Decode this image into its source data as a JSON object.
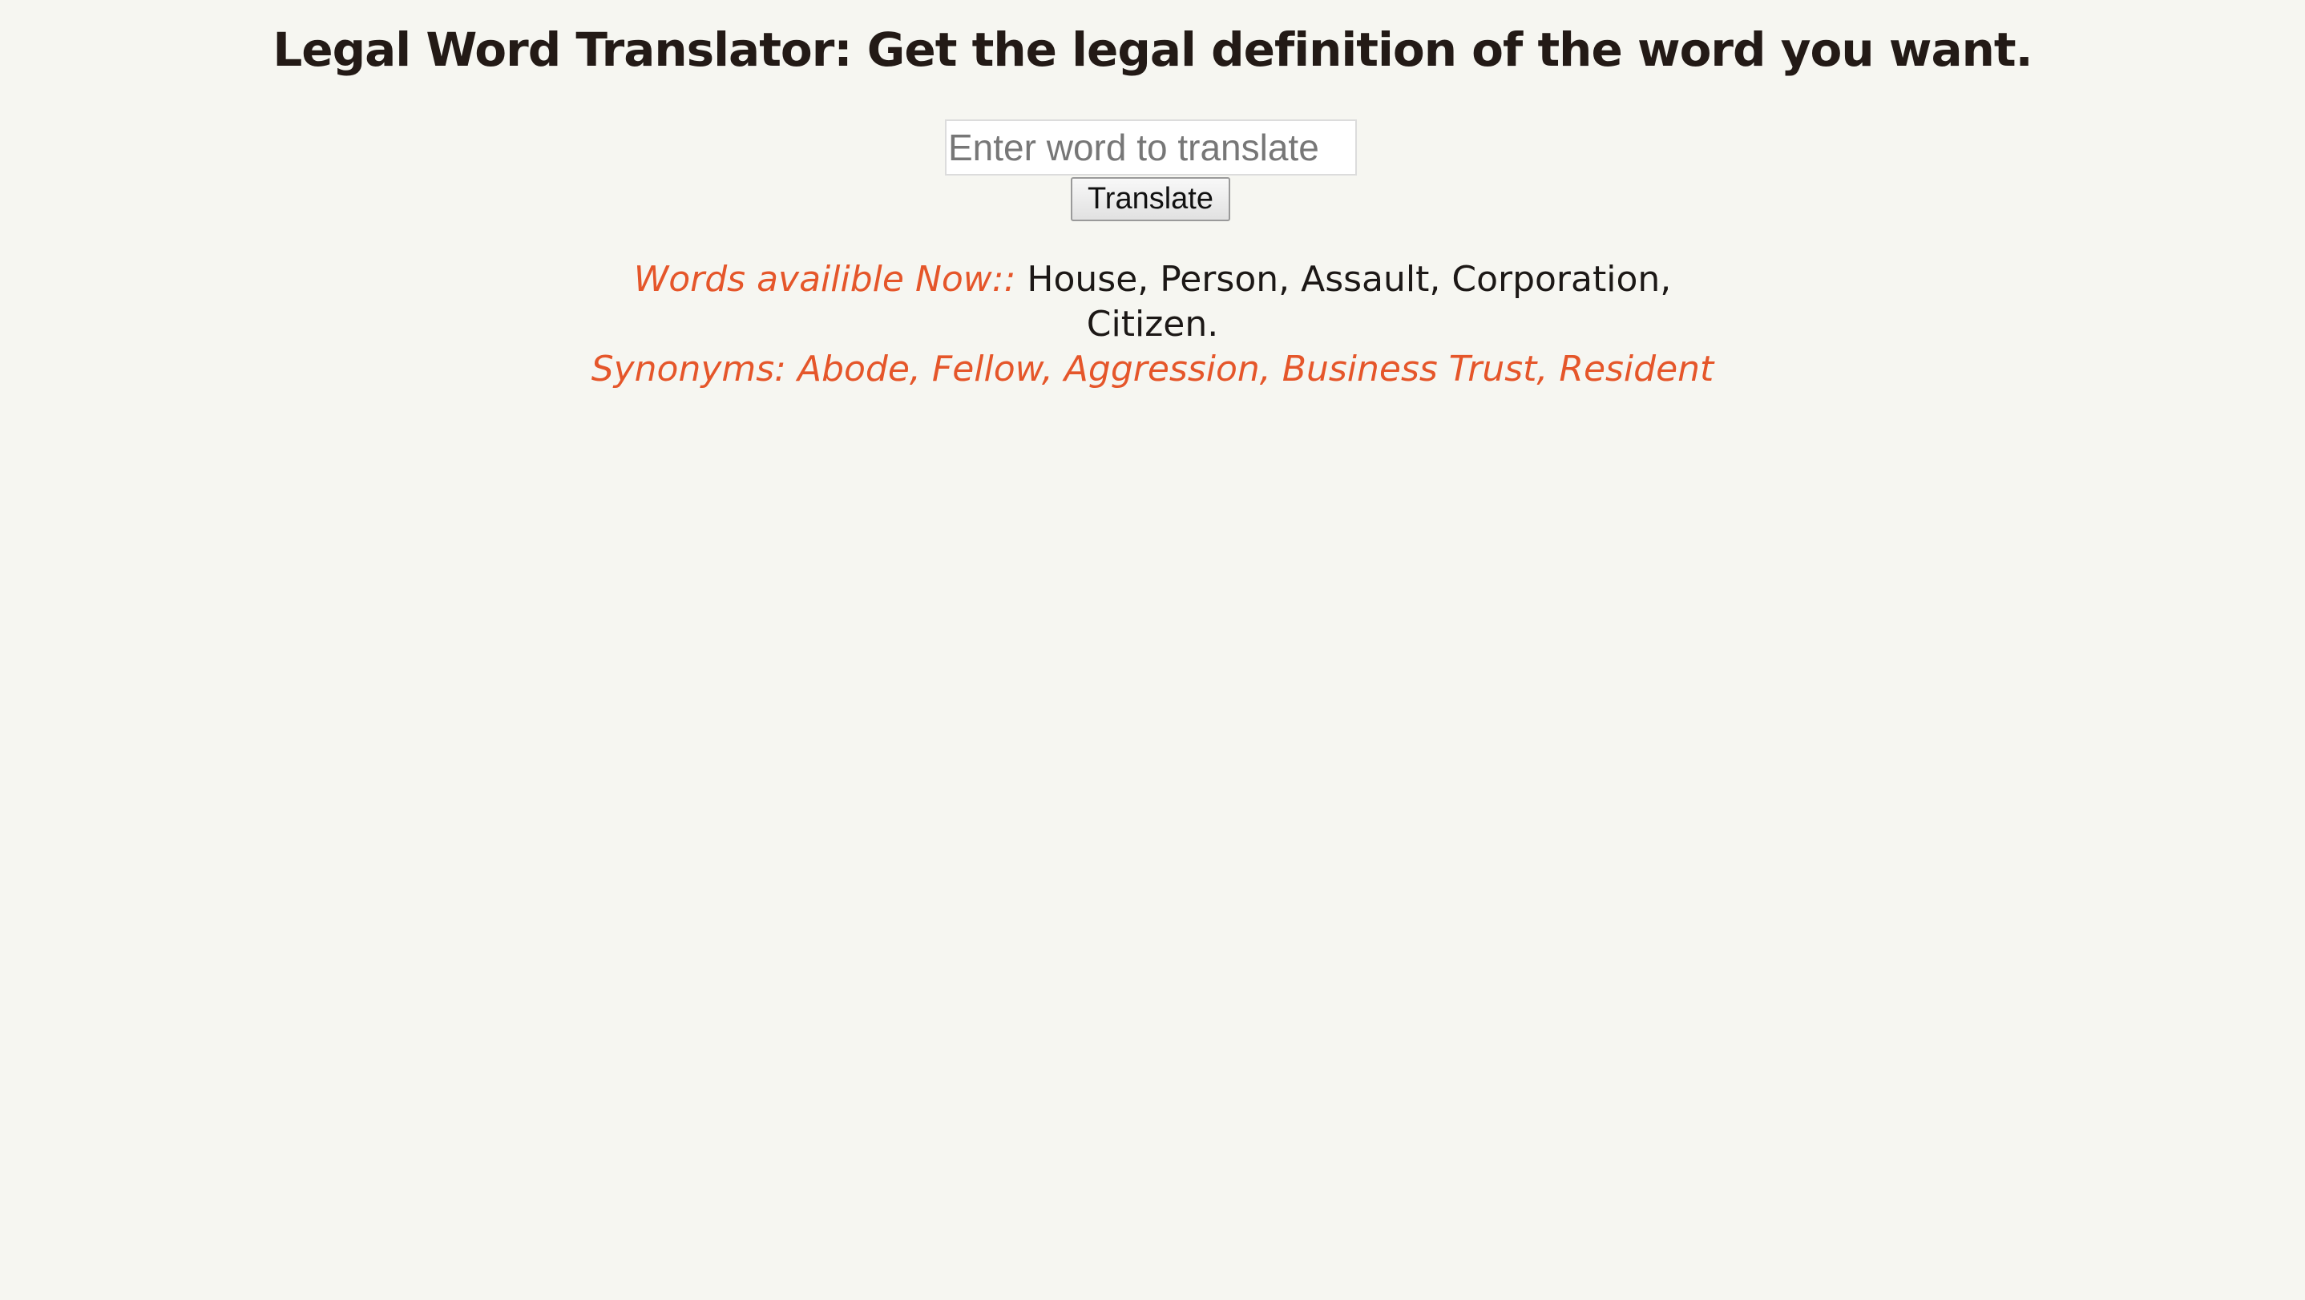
{
  "header": {
    "title": "Legal Word Translator: Get the legal definition of the word you want."
  },
  "form": {
    "input_placeholder": "Enter word to translate",
    "input_value": "",
    "button_label": "Translate"
  },
  "info": {
    "available_label": "Words availible Now::",
    "available_words_line1": " House, Person, Assault, Corporation,",
    "available_words_line2": "Citizen.",
    "synonyms_text": "Synonyms: Abode, Fellow, Aggression, Business Trust, Resident"
  },
  "colors": {
    "background": "#f6f6f1",
    "accent": "#e5562a",
    "text": "#231a16"
  }
}
